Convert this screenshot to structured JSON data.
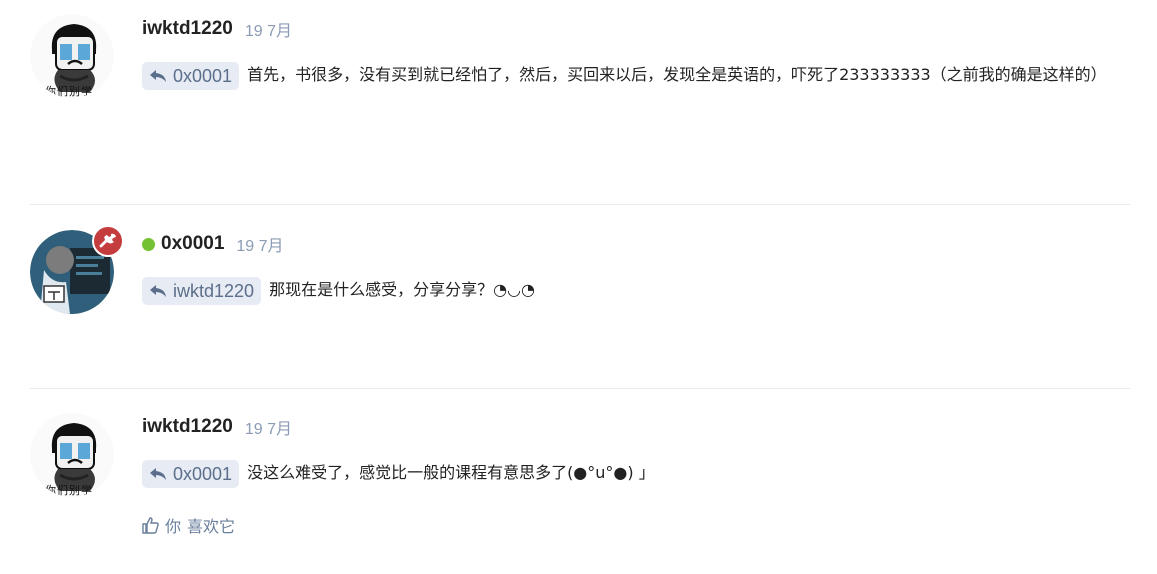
{
  "posts": [
    {
      "username": "iwktd1220",
      "time": "19 7月",
      "reply_to": "0x0001",
      "text": "首先，书很多，没有买到就已经怕了，然后，买回来以后，发现全是英语的，吓死了233333333（之前我的确是这样的）",
      "avatar_text": "你们别学",
      "avatar_icon": "crying-meme-face-icon"
    },
    {
      "username": "0x0001",
      "time": "19 7月",
      "online": true,
      "reply_to": "iwktd1220",
      "text": "那现在是什么感受，分享分享？◔◡◔",
      "avatar_icon": "anime-avatar-icon",
      "badge_icon": "wrench-icon",
      "badge_color": "#c53c3f",
      "online_color": "#74c232"
    },
    {
      "username": "iwktd1220",
      "time": "19 7月",
      "reply_to": "0x0001",
      "text": "没这么难受了，感觉比一般的课程有意思多了(●°u°●)​ 」",
      "avatar_text": "你们别学",
      "avatar_icon": "crying-meme-face-icon",
      "likes": {
        "you": "你",
        "label": "喜欢它"
      }
    }
  ]
}
